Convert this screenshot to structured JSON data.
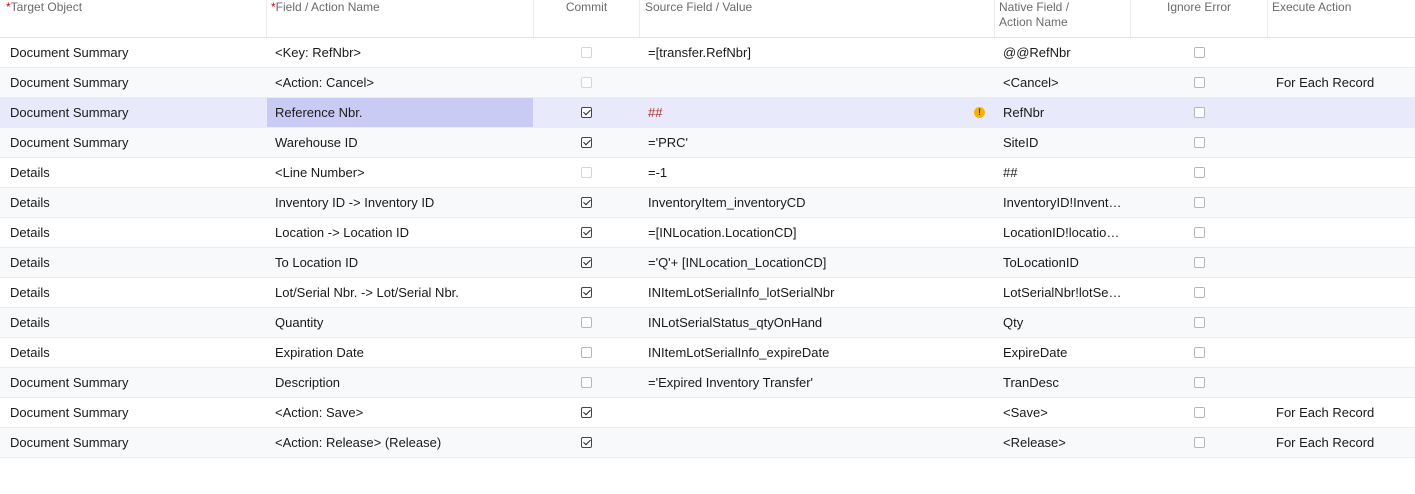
{
  "header": {
    "target_object": "Target Object",
    "field_action": "Field / Action Name",
    "commit": "Commit",
    "source_field": "Source Field / Value",
    "native_line1": "Native Field /",
    "native_line2": "Action Name",
    "ignore_error": "Ignore Error",
    "execute_action": "Execute Action",
    "required_mark": "*"
  },
  "colors": {
    "selected_row": "#e8e9fb",
    "active_cell": "#c9cbf5",
    "warning": "#f3b30b",
    "error_text": "#b0302b"
  },
  "rows": [
    {
      "target": "Document Summary",
      "field": "<Key: RefNbr>",
      "commit": "disabled",
      "source": "=[transfer.RefNbr]",
      "native": "@@RefNbr",
      "ignore": false,
      "exec": ""
    },
    {
      "target": "Document Summary",
      "field": "<Action: Cancel>",
      "commit": "disabled",
      "source": "",
      "native": "<Cancel>",
      "ignore": false,
      "exec": "For Each Record"
    },
    {
      "target": "Document Summary",
      "field": "Reference Nbr.",
      "commit": "checked",
      "source": "##",
      "native": "RefNbr",
      "ignore": false,
      "exec": "",
      "selected": true,
      "warning": "!"
    },
    {
      "target": "Document Summary",
      "field": "Warehouse ID",
      "commit": "checked",
      "source": "='PRC'",
      "native": "SiteID",
      "ignore": false,
      "exec": ""
    },
    {
      "target": "Details",
      "field": "<Line Number>",
      "commit": "disabled",
      "source": "=-1",
      "native": "##",
      "ignore": false,
      "exec": ""
    },
    {
      "target": "Details",
      "field": "Inventory ID -> Inventory ID",
      "commit": "checked",
      "source": "InventoryItem_inventoryCD",
      "native": "InventoryID!InventoryCD",
      "ignore": false,
      "exec": ""
    },
    {
      "target": "Details",
      "field": "Location -> Location ID",
      "commit": "checked",
      "source": "=[INLocation.LocationCD]",
      "native": "LocationID!locationCD",
      "ignore": false,
      "exec": ""
    },
    {
      "target": "Details",
      "field": "To Location ID",
      "commit": "checked",
      "source": "='Q'+ [INLocation_LocationCD]",
      "native": "ToLocationID",
      "ignore": false,
      "exec": ""
    },
    {
      "target": "Details",
      "field": "Lot/Serial Nbr. -> Lot/Serial Nbr.",
      "commit": "checked",
      "source": "INItemLotSerialInfo_lotSerialNbr",
      "native": "LotSerialNbr!lotSerialNbr",
      "ignore": false,
      "exec": ""
    },
    {
      "target": "Details",
      "field": "Quantity",
      "commit": "unchecked",
      "source": "INLotSerialStatus_qtyOnHand",
      "native": "Qty",
      "ignore": false,
      "exec": ""
    },
    {
      "target": "Details",
      "field": "Expiration Date",
      "commit": "unchecked",
      "source": "INItemLotSerialInfo_expireDate",
      "native": "ExpireDate",
      "ignore": false,
      "exec": ""
    },
    {
      "target": "Document Summary",
      "field": "Description",
      "commit": "unchecked",
      "source": "='Expired Inventory Transfer'",
      "native": "TranDesc",
      "ignore": false,
      "exec": ""
    },
    {
      "target": "Document Summary",
      "field": "<Action: Save>",
      "commit": "checked",
      "source": "",
      "native": "<Save>",
      "ignore": false,
      "exec": "For Each Record"
    },
    {
      "target": "Document Summary",
      "field": "<Action: Release> (Release)",
      "commit": "checked",
      "source": "",
      "native": "<Release>",
      "ignore": false,
      "exec": "For Each Record"
    }
  ]
}
